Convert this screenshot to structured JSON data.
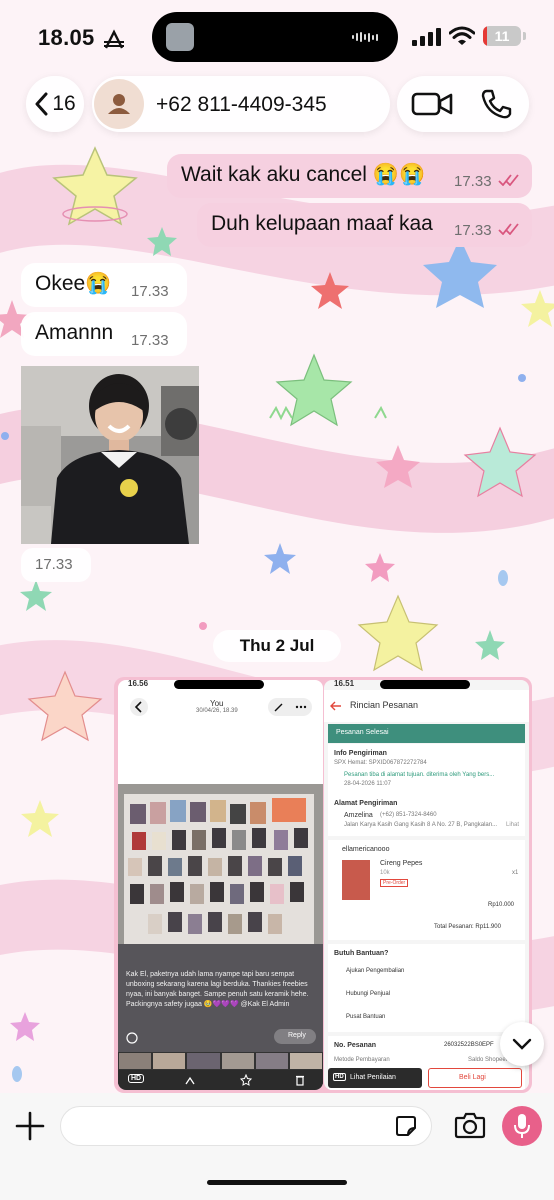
{
  "status_bar": {
    "time": "18.05",
    "battery": "11",
    "battery_fraction": 0.11,
    "icons": [
      "alarm-icon",
      "music-icon",
      "cellular-signal-icon",
      "wifi-icon",
      "battery-icon"
    ]
  },
  "header": {
    "back_count": "16",
    "contact_name": "+62 811-4409-345",
    "icons": [
      "back-chevron-icon",
      "avatar-icon",
      "video-call-icon",
      "phone-call-icon"
    ]
  },
  "messages": [
    {
      "direction": "out",
      "text": "Wait kak aku cancel 😭😭",
      "time": "17.33",
      "status": "read"
    },
    {
      "direction": "out",
      "text": "Duh kelupaan maaf kaa",
      "time": "17.33",
      "status": "read"
    },
    {
      "direction": "in",
      "text": "Okee😭",
      "time": "17.33"
    },
    {
      "direction": "in",
      "text": "Amannn",
      "time": "17.33"
    },
    {
      "direction": "in",
      "type": "photo",
      "time": "17.33"
    }
  ],
  "date_separator": "Thu 2 Jul",
  "album": {
    "shot_a": {
      "status_time": "16.56",
      "title": "You",
      "subtitle": "30/04/26, 18.39",
      "caption": "Kak El, paketnya udah lama nyampe tapi baru sempat unboxing sekarang karena lagi berduka. Thankies freebies nyaa, ini banyak banget. Sampe penuh satu keramik hehe. Packingnya safety jugaa 🥹💜💜💜 @Kak El Admin",
      "reply_label": "Reply",
      "hd_badge": "HD"
    },
    "shot_b": {
      "status_time": "16.51",
      "title": "Rincian Pesanan",
      "order_status": "Pesanan Selesai",
      "shipping_info_label": "Info Pengiriman",
      "shipping_courier": "SPX Hemat: SPXID067872272784",
      "shipping_status": "Pesanan tiba di alamat tujuan. diterima oleh Yang bers...",
      "shipping_date": "28-04-2026 11:07",
      "address_label": "Alamat Pengiriman",
      "address_name": "Amzelina",
      "address_phone": "(+62) 851-7324-8460",
      "address_line": "Jalan Karya Kasih Gang Kasih 8 A No. 27 B, Pangkalan...",
      "address_more": "Lihat",
      "shop_name": "ellamericanooo",
      "product_name": "Cireng Pepes",
      "product_variant": "10k",
      "product_badge": "Pre-Order",
      "product_qty": "x1",
      "product_price": "Rp10.000",
      "order_total": "Total Pesanan: Rp11.900",
      "help_label": "Butuh Bantuan?",
      "help_items": [
        "Ajukan Pengembalian",
        "Hubungi Penjual",
        "Pusat Bantuan"
      ],
      "order_no_label": "No. Pesanan",
      "order_no": "26032522BS0EPF",
      "payment_label": "Metode Pembayaran",
      "payment_value": "Saldo ShopeePay",
      "rating_button": "Lihat Penilaian",
      "buy_again_button": "Beli Lagi",
      "hd_badge": "HD"
    }
  },
  "composer": {
    "placeholder": "",
    "icons": [
      "plus-icon",
      "sticker-icon",
      "camera-icon",
      "microphone-icon"
    ]
  },
  "colors": {
    "outgoing_bubble": "#f6d0e0",
    "incoming_bubble": "#ffffff",
    "read_ticks": "#d9577f",
    "mic_button": "#e8608a",
    "shopee_header": "#3e8f7d"
  }
}
